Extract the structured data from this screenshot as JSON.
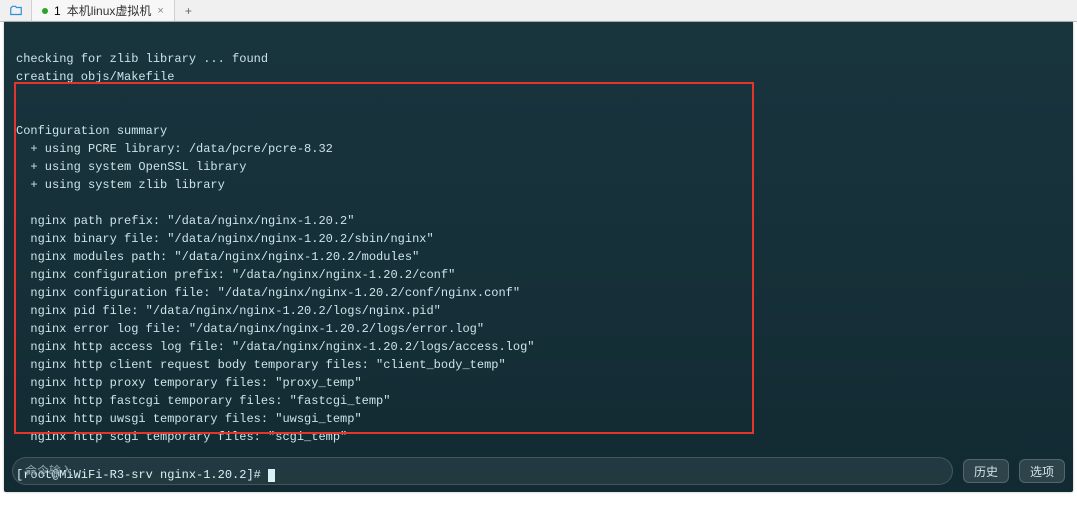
{
  "tabBar": {
    "tab": {
      "badge": "1",
      "label": "本机linux虚拟机",
      "close": "×"
    },
    "addTab": "+"
  },
  "terminal": {
    "line0": "checking for zlib library ... found",
    "line1": "creating objs/Makefile",
    "blank0": "",
    "blank0b": "",
    "line2": "Configuration summary",
    "line3": "  + using PCRE library: /data/pcre/pcre-8.32",
    "line4": "  + using system OpenSSL library",
    "line5": "  + using system zlib library",
    "blank1": "",
    "line6": "  nginx path prefix: \"/data/nginx/nginx-1.20.2\"",
    "line7": "  nginx binary file: \"/data/nginx/nginx-1.20.2/sbin/nginx\"",
    "line8": "  nginx modules path: \"/data/nginx/nginx-1.20.2/modules\"",
    "line9": "  nginx configuration prefix: \"/data/nginx/nginx-1.20.2/conf\"",
    "line10": "  nginx configuration file: \"/data/nginx/nginx-1.20.2/conf/nginx.conf\"",
    "line11": "  nginx pid file: \"/data/nginx/nginx-1.20.2/logs/nginx.pid\"",
    "line12": "  nginx error log file: \"/data/nginx/nginx-1.20.2/logs/error.log\"",
    "line13": "  nginx http access log file: \"/data/nginx/nginx-1.20.2/logs/access.log\"",
    "line14": "  nginx http client request body temporary files: \"client_body_temp\"",
    "line15": "  nginx http proxy temporary files: \"proxy_temp\"",
    "line16": "  nginx http fastcgi temporary files: \"fastcgi_temp\"",
    "line17": "  nginx http uwsgi temporary files: \"uwsgi_temp\"",
    "line18": "  nginx http scgi temporary files: \"scgi_temp\"",
    "blank2": "",
    "prompt": "[root@MiWiFi-R3-srv nginx-1.20.2]#"
  },
  "inputBar": {
    "placeholder": "命令输入",
    "history": "历史",
    "options": "选项"
  }
}
